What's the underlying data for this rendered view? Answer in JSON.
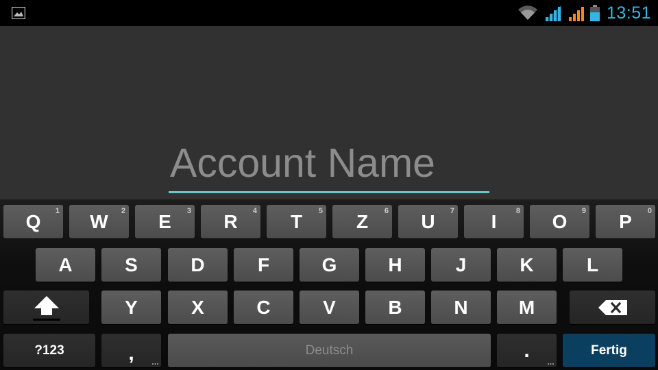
{
  "status_bar": {
    "notification_icon": "image-icon",
    "wifi_icon": "wifi-icon",
    "signal_icons": [
      "signal-blue-icon",
      "signal-orange-icon"
    ],
    "battery_icon": "battery-icon",
    "time": "13:51",
    "time_color": "#33b5e5"
  },
  "form": {
    "account_name": {
      "placeholder": "Account Name",
      "value": "",
      "underline_color": "#6cc7cc"
    }
  },
  "keyboard": {
    "row1": [
      {
        "label": "Q",
        "hint": "1"
      },
      {
        "label": "W",
        "hint": "2"
      },
      {
        "label": "E",
        "hint": "3"
      },
      {
        "label": "R",
        "hint": "4"
      },
      {
        "label": "T",
        "hint": "5"
      },
      {
        "label": "Z",
        "hint": "6"
      },
      {
        "label": "U",
        "hint": "7"
      },
      {
        "label": "I",
        "hint": "8"
      },
      {
        "label": "O",
        "hint": "9"
      },
      {
        "label": "P",
        "hint": "0"
      }
    ],
    "row2": [
      "A",
      "S",
      "D",
      "F",
      "G",
      "H",
      "J",
      "K",
      "L"
    ],
    "row3": [
      "Y",
      "X",
      "C",
      "V",
      "B",
      "N",
      "M"
    ],
    "shift_icon": "shift-arrow-icon",
    "delete_icon": "backspace-icon",
    "symbols_label": "?123",
    "comma_label": ",",
    "comma_more": "…",
    "space_label": "Deutsch",
    "period_label": ".",
    "period_more": "…",
    "done_label": "Fertig",
    "done_color": "#0a3f5f"
  }
}
